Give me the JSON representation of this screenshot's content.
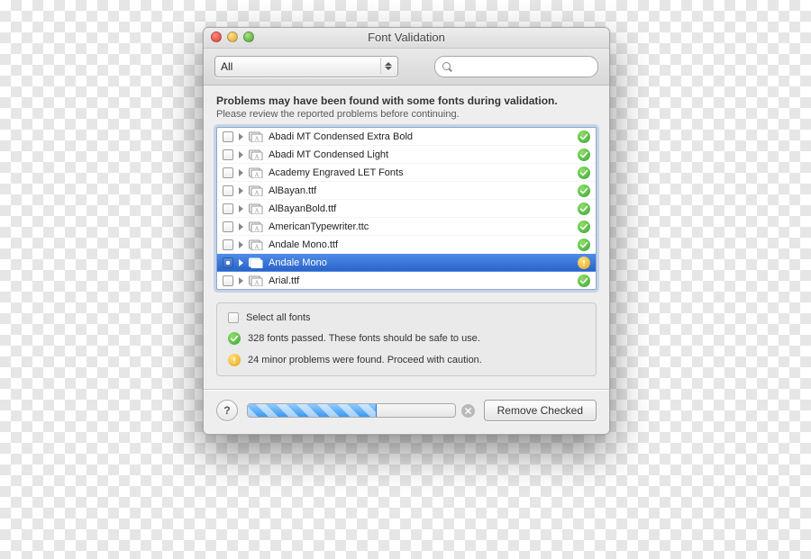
{
  "window": {
    "title": "Font Validation"
  },
  "toolbar": {
    "filter_value": "All",
    "search_placeholder": ""
  },
  "message": {
    "heading": "Problems may have been found with some fonts during validation.",
    "subhead": "Please review the reported problems before continuing."
  },
  "fonts": [
    {
      "name": "Abadi MT Condensed Extra Bold",
      "status": "ok",
      "selected": false,
      "checked": false
    },
    {
      "name": "Abadi MT Condensed Light",
      "status": "ok",
      "selected": false,
      "checked": false
    },
    {
      "name": "Academy Engraved LET Fonts",
      "status": "ok",
      "selected": false,
      "checked": false
    },
    {
      "name": "AlBayan.ttf",
      "status": "ok",
      "selected": false,
      "checked": false
    },
    {
      "name": "AlBayanBold.ttf",
      "status": "ok",
      "selected": false,
      "checked": false
    },
    {
      "name": "AmericanTypewriter.ttc",
      "status": "ok",
      "selected": false,
      "checked": false
    },
    {
      "name": "Andale Mono.ttf",
      "status": "ok",
      "selected": false,
      "checked": false
    },
    {
      "name": "Andale Mono",
      "status": "warn",
      "selected": true,
      "checked": true
    },
    {
      "name": "Arial.ttf",
      "status": "ok",
      "selected": false,
      "checked": false
    }
  ],
  "summary": {
    "select_all_label": "Select all fonts",
    "select_all_checked": false,
    "passed_text": "328 fonts passed. These fonts should be safe to use.",
    "minor_text": "24 minor problems were found. Proceed with caution."
  },
  "footer": {
    "progress_percent": 62,
    "remove_label": "Remove Checked"
  },
  "colors": {
    "selection": "#3b72d3",
    "ok": "#44b03d",
    "warn": "#e8a81e"
  }
}
